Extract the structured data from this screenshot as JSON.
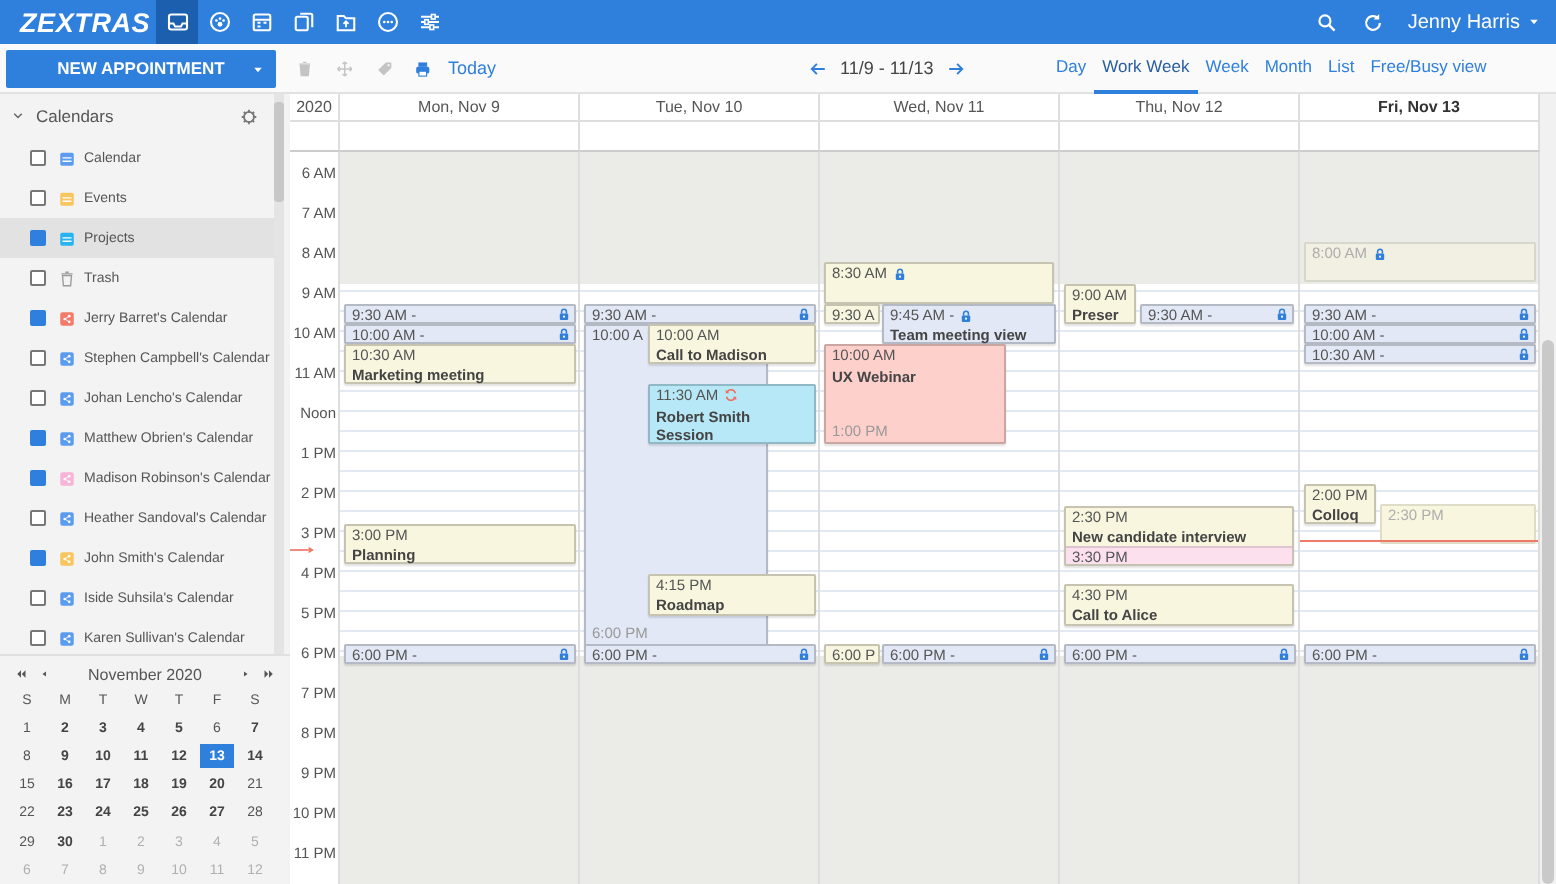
{
  "topbar": {
    "logo": "ZEXTRAS",
    "apps": [
      {
        "kind": "mail",
        "selected": true
      },
      {
        "kind": "contacts",
        "selected": false
      },
      {
        "kind": "calendar",
        "selected": false
      },
      {
        "kind": "tasks",
        "selected": false
      },
      {
        "kind": "files",
        "selected": false
      },
      {
        "kind": "chat",
        "selected": false
      },
      {
        "kind": "settings",
        "selected": false
      }
    ],
    "user": "Jenny Harris"
  },
  "toolbar": {
    "new_button": "NEW APPOINTMENT",
    "actions": [
      {
        "kind": "delete",
        "disabled": true
      },
      {
        "kind": "move",
        "disabled": true
      },
      {
        "kind": "tag",
        "disabled": true
      },
      {
        "kind": "print",
        "disabled": false
      }
    ],
    "today": "Today",
    "range": "11/9 - 11/13",
    "views": [
      {
        "label": "Day",
        "selected": false
      },
      {
        "label": "Work Week",
        "selected": true
      },
      {
        "label": "Week",
        "selected": false
      },
      {
        "label": "Month",
        "selected": false
      },
      {
        "label": "List",
        "selected": false
      },
      {
        "label": "Free/Busy view",
        "selected": false
      }
    ]
  },
  "sidebar": {
    "title": "Calendars",
    "calendars": [
      {
        "label": "Calendar",
        "kind": "calendar",
        "color": "#5b9cf0",
        "checked": false,
        "selected": false
      },
      {
        "label": "Events",
        "kind": "calendar",
        "color": "#f8c55f",
        "checked": false,
        "selected": false
      },
      {
        "label": "Projects",
        "kind": "calendar",
        "color": "#27b4f0",
        "checked": true,
        "selected": true
      },
      {
        "label": "Trash",
        "kind": "trash",
        "color": "#9a9a9a",
        "checked": false,
        "selected": false
      },
      {
        "label": "Jerry Barret's Calendar",
        "kind": "shared",
        "color": "#f47a6a",
        "checked": true,
        "selected": false
      },
      {
        "label": "Stephen Campbell's Calendar",
        "kind": "shared",
        "color": "#5b9cf0",
        "checked": false,
        "selected": false
      },
      {
        "label": "Johan Lencho's Calendar",
        "kind": "shared",
        "color": "#5b9cf0",
        "checked": false,
        "selected": false
      },
      {
        "label": "Matthew Obrien's Calendar",
        "kind": "shared",
        "color": "#5b9cf0",
        "checked": true,
        "selected": false
      },
      {
        "label": "Madison Robinson's Calendar",
        "kind": "shared",
        "color": "#f7b4d8",
        "checked": true,
        "selected": false
      },
      {
        "label": "Heather Sandoval's Calendar",
        "kind": "shared",
        "color": "#5b9cf0",
        "checked": false,
        "selected": false
      },
      {
        "label": "John Smith's Calendar",
        "kind": "shared",
        "color": "#f8c55f",
        "checked": true,
        "selected": false
      },
      {
        "label": "Iside Suhsila's Calendar",
        "kind": "shared",
        "color": "#5b9cf0",
        "checked": false,
        "selected": false
      },
      {
        "label": "Karen Sullivan's Calendar",
        "kind": "shared",
        "color": "#5b9cf0",
        "checked": false,
        "selected": false
      }
    ]
  },
  "mini_calendar": {
    "title": "November 2020",
    "weekdays": [
      "S",
      "M",
      "T",
      "W",
      "T",
      "F",
      "S"
    ],
    "days": [
      {
        "d": "1",
        "other_month": false,
        "bold": false,
        "selected": false
      },
      {
        "d": "2",
        "other_month": false,
        "bold": true,
        "selected": false
      },
      {
        "d": "3",
        "other_month": false,
        "bold": true,
        "selected": false
      },
      {
        "d": "4",
        "other_month": false,
        "bold": true,
        "selected": false
      },
      {
        "d": "5",
        "other_month": false,
        "bold": true,
        "selected": false
      },
      {
        "d": "6",
        "other_month": false,
        "bold": false,
        "selected": false
      },
      {
        "d": "7",
        "other_month": false,
        "bold": true,
        "selected": false
      },
      {
        "d": "8",
        "other_month": false,
        "bold": false,
        "selected": false
      },
      {
        "d": "9",
        "other_month": false,
        "bold": true,
        "selected": false
      },
      {
        "d": "10",
        "other_month": false,
        "bold": true,
        "selected": false
      },
      {
        "d": "11",
        "other_month": false,
        "bold": true,
        "selected": false
      },
      {
        "d": "12",
        "other_month": false,
        "bold": true,
        "selected": false
      },
      {
        "d": "13",
        "other_month": false,
        "bold": true,
        "selected": true
      },
      {
        "d": "14",
        "other_month": false,
        "bold": true,
        "selected": false
      },
      {
        "d": "15",
        "other_month": false,
        "bold": false,
        "selected": false
      },
      {
        "d": "16",
        "other_month": false,
        "bold": true,
        "selected": false
      },
      {
        "d": "17",
        "other_month": false,
        "bold": true,
        "selected": false
      },
      {
        "d": "18",
        "other_month": false,
        "bold": true,
        "selected": false
      },
      {
        "d": "19",
        "other_month": false,
        "bold": true,
        "selected": false
      },
      {
        "d": "20",
        "other_month": false,
        "bold": true,
        "selected": false
      },
      {
        "d": "21",
        "other_month": false,
        "bold": false,
        "selected": false
      },
      {
        "d": "22",
        "other_month": false,
        "bold": false,
        "selected": false
      },
      {
        "d": "23",
        "other_month": false,
        "bold": true,
        "selected": false
      },
      {
        "d": "24",
        "other_month": false,
        "bold": true,
        "selected": false
      },
      {
        "d": "25",
        "other_month": false,
        "bold": true,
        "selected": false
      },
      {
        "d": "26",
        "other_month": false,
        "bold": true,
        "selected": false
      },
      {
        "d": "27",
        "other_month": false,
        "bold": true,
        "selected": false
      },
      {
        "d": "28",
        "other_month": false,
        "bold": false,
        "selected": false
      },
      {
        "d": "29",
        "other_month": false,
        "bold": false,
        "selected": false
      },
      {
        "d": "30",
        "other_month": false,
        "bold": true,
        "selected": false
      },
      {
        "d": "1",
        "other_month": true,
        "bold": false,
        "selected": false
      },
      {
        "d": "2",
        "other_month": true,
        "bold": false,
        "selected": false
      },
      {
        "d": "3",
        "other_month": true,
        "bold": false,
        "selected": false
      },
      {
        "d": "4",
        "other_month": true,
        "bold": false,
        "selected": false
      },
      {
        "d": "5",
        "other_month": true,
        "bold": false,
        "selected": false
      },
      {
        "d": "6",
        "other_month": true,
        "bold": false,
        "selected": false
      },
      {
        "d": "7",
        "other_month": true,
        "bold": false,
        "selected": false
      },
      {
        "d": "8",
        "other_month": true,
        "bold": false,
        "selected": false
      },
      {
        "d": "9",
        "other_month": true,
        "bold": false,
        "selected": false
      },
      {
        "d": "10",
        "other_month": true,
        "bold": false,
        "selected": false
      },
      {
        "d": "11",
        "other_month": true,
        "bold": false,
        "selected": false
      },
      {
        "d": "12",
        "other_month": true,
        "bold": false,
        "selected": false
      }
    ]
  },
  "week": {
    "year": "2020",
    "hours": [
      "6 AM",
      "7 AM",
      "8 AM",
      "9 AM",
      "10 AM",
      "11 AM",
      "Noon",
      "1 PM",
      "2 PM",
      "3 PM",
      "4 PM",
      "5 PM",
      "6 PM",
      "7 PM",
      "8 PM",
      "9 PM",
      "10 PM",
      "11 PM"
    ],
    "days": [
      {
        "label": "Mon, Nov 9",
        "today": false,
        "events": [
          {
            "time": "9:30 AM -",
            "color": "#e2e8f5",
            "locked": true
          },
          {
            "time": "10:00 AM -",
            "color": "#e2e8f5",
            "locked": true
          },
          {
            "time": "10:30 AM",
            "title": "Marketing meeting",
            "color": "#f8f6de"
          },
          {
            "time": "3:00 PM",
            "title": "Planning",
            "color": "#f8f6de"
          },
          {
            "time": "6:00 PM -",
            "color": "#e2e8f5",
            "locked": true
          }
        ]
      },
      {
        "label": "Tue, Nov 10",
        "today": false,
        "events": [
          {
            "time": "9:30 AM -",
            "color": "#e2e8f5",
            "locked": true
          },
          {
            "time": "10:00 A",
            "end": {
              "text": "6:00 PM"
            },
            "color": "#e2e8f5"
          },
          {
            "time": "10:00 AM",
            "title": "Call to Madison",
            "color": "#f8f6de"
          },
          {
            "time": "11:30 AM",
            "title": "Robert Smith Session",
            "color": "#b6e8f7",
            "recurring": true
          },
          {
            "time": "4:15 PM",
            "title": "Roadmap",
            "color": "#f8f6de"
          },
          {
            "time": "6:00 PM -",
            "color": "#e2e8f5",
            "locked": true
          }
        ]
      },
      {
        "label": "Wed, Nov 11",
        "today": false,
        "events": [
          {
            "time": "8:30 AM",
            "color": "#f8f6de",
            "locked": true
          },
          {
            "time": "9:30 A",
            "color": "#f8f6de"
          },
          {
            "time": "9:45 AM -",
            "title": "Team meeting view",
            "color": "#e2e8f5",
            "locked": true
          },
          {
            "time": "10:00 AM",
            "title": "UX Webinar",
            "end": {
              "text": "1:00 PM"
            },
            "color": "#fdd0cc"
          },
          {
            "time": "6:00 P",
            "color": "#f8f6de"
          },
          {
            "time": "6:00 PM -",
            "color": "#e2e8f5",
            "locked": true
          }
        ]
      },
      {
        "label": "Thu, Nov 12",
        "today": false,
        "events": [
          {
            "time": "9:00 AM",
            "title": "Preser",
            "color": "#f8f6de"
          },
          {
            "time": "9:30 AM -",
            "color": "#e2e8f5",
            "locked": true
          },
          {
            "time": "2:30 PM",
            "title": "New candidate interview",
            "end": {
              "text": "3:30 PM",
              "color": "#fde0ee"
            },
            "color": "#f8f6de"
          },
          {
            "time": "4:30 PM",
            "title": "Call to Alice",
            "color": "#f8f6de"
          },
          {
            "time": "6:00 PM -",
            "color": "#e2e8f5",
            "locked": true
          }
        ]
      },
      {
        "label": "Fri, Nov 13",
        "today": true,
        "events": [
          {
            "time": "8:00 AM",
            "color": "#f1f0e2",
            "locked": true,
            "faded": true
          },
          {
            "time": "9:30 AM -",
            "color": "#e2e8f5",
            "locked": true
          },
          {
            "time": "10:00 AM -",
            "color": "#e2e8f5",
            "locked": true
          },
          {
            "time": "10:30 AM -",
            "color": "#e2e8f5",
            "locked": true
          },
          {
            "time": "2:00 PM",
            "title": "Colloq",
            "color": "#f8f6de"
          },
          {
            "time": "2:30 PM",
            "color": "#f8f6de",
            "faded": true
          },
          {
            "time": "6:00 PM -",
            "color": "#e2e8f5",
            "locked": true
          }
        ]
      }
    ]
  }
}
